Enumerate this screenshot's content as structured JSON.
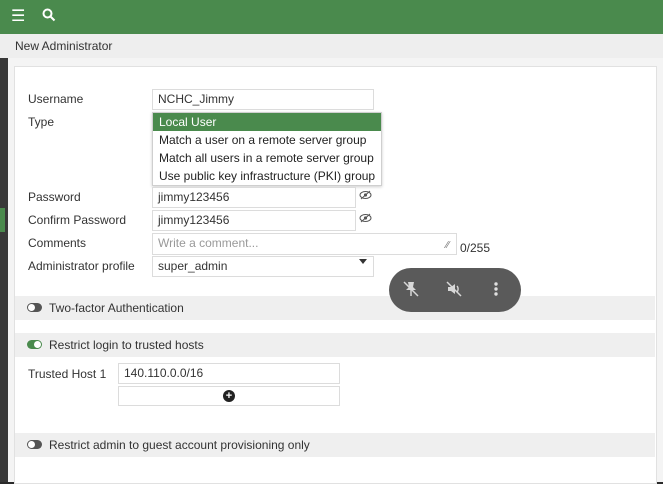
{
  "topbar": {
    "menu_icon": "hamburger-menu-icon",
    "search_icon": "search-icon"
  },
  "page": {
    "title": "New Administrator"
  },
  "form": {
    "username_label": "Username",
    "username_value": "NCHC_Jimmy",
    "type_label": "Type",
    "type_options": [
      "Local User",
      "Match a user on a remote server group",
      "Match all users in a remote server group",
      "Use public key infrastructure (PKI) group"
    ],
    "type_selected": "Local User",
    "password_label": "Password",
    "password_value": "jimmy123456",
    "confirm_label": "Confirm Password",
    "confirm_value": "jimmy123456",
    "comments_label": "Comments",
    "comments_placeholder": "Write a comment...",
    "comments_counter": "0/255",
    "profile_label": "Administrator profile",
    "profile_value": "super_admin"
  },
  "sections": {
    "two_factor": {
      "label": "Two-factor Authentication",
      "enabled": false
    },
    "restrict_login": {
      "label": "Restrict login to trusted hosts",
      "enabled": true
    },
    "restrict_guest": {
      "label": "Restrict admin to guest account provisioning only",
      "enabled": false
    }
  },
  "trusted_hosts": {
    "label": "Trusted Host 1",
    "value": "140.110.0.0/16",
    "add_icon": "plus-circle-icon"
  },
  "overlay": {
    "icons": [
      "pin-off-icon",
      "speaker-muted-icon",
      "more-vertical-icon"
    ]
  }
}
